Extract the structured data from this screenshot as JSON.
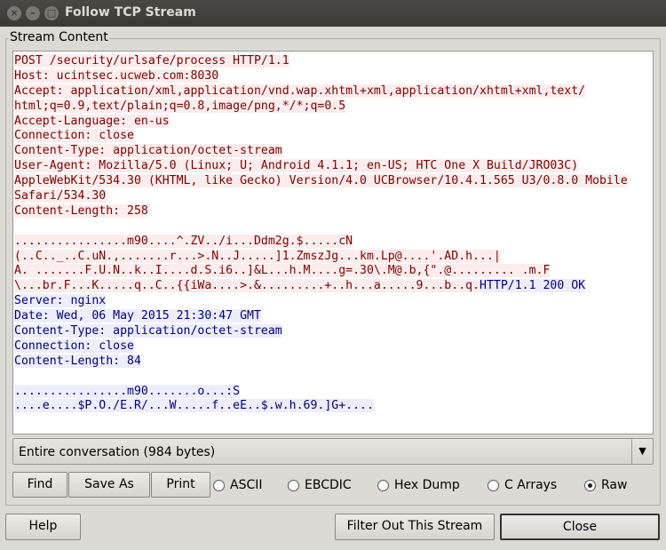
{
  "window": {
    "title": "Follow TCP Stream"
  },
  "group_label": "Stream Content",
  "stream": {
    "lines": [
      [
        {
          "t": "POST /security/urlsafe/process HTTP/1.1",
          "d": "c"
        }
      ],
      [
        {
          "t": "Host: ucintsec.ucweb.com:8030",
          "d": "c"
        }
      ],
      [
        {
          "t": "Accept: application/xml,application/vnd.wap.xhtml+xml,application/xhtml+xml,text/",
          "d": "c"
        }
      ],
      [
        {
          "t": "html;q=0.9,text/plain;q=0.8,image/png,*/*;q=0.5",
          "d": "c"
        }
      ],
      [
        {
          "t": "Accept-Language: en-us",
          "d": "c"
        }
      ],
      [
        {
          "t": "Connection: close",
          "d": "c"
        }
      ],
      [
        {
          "t": "Content-Type: application/octet-stream",
          "d": "c"
        }
      ],
      [
        {
          "t": "User-Agent: Mozilla/5.0 (Linux; U; Android 4.1.1; en-US; HTC One X Build/JRO03C)",
          "d": "c"
        }
      ],
      [
        {
          "t": "AppleWebKit/534.30 (KHTML, like Gecko) Version/4.0 UCBrowser/10.4.1.565 U3/0.8.0 Mobile",
          "d": "c"
        }
      ],
      [
        {
          "t": "Safari/534.30",
          "d": "c"
        }
      ],
      [
        {
          "t": "Content-Length: 258",
          "d": "c"
        }
      ],
      [],
      [
        {
          "t": "................m90....^.ZV../i...Ddm2g.$.....cN",
          "d": "c"
        }
      ],
      [
        {
          "t": "(..C.._..C.uN.,.......r...>.N..J.....]1.ZmszJg...km.Lp@....'.AD.h...|",
          "d": "c"
        }
      ],
      [
        {
          "t": "A. .......F.U.N..k..I....d.S.i6..]&L...h.M....g=.30\\.M@.b,{\".@......... .m.F",
          "d": "c"
        }
      ],
      [
        {
          "t": "\\...br.F...K.....q..C..{{iWa....>.&.........+..h...a.....9...b..q.",
          "d": "c"
        },
        {
          "t": "HTTP/1.1 200 OK",
          "d": "s"
        }
      ],
      [
        {
          "t": "Server: nginx",
          "d": "s"
        }
      ],
      [
        {
          "t": "Date: Wed, 06 May 2015 21:30:47 GMT",
          "d": "s"
        }
      ],
      [
        {
          "t": "Content-Type: application/octet-stream",
          "d": "s"
        }
      ],
      [
        {
          "t": "Connection: close",
          "d": "s"
        }
      ],
      [
        {
          "t": "Content-Length: 84",
          "d": "s"
        }
      ],
      [],
      [
        {
          "t": "................m90.......o...:S",
          "d": "s"
        }
      ],
      [
        {
          "t": "....e....$P.O./E.R/...W.....f..eE..$.w.h.69.]G+....",
          "d": "s"
        }
      ]
    ]
  },
  "conversation_select": "Entire conversation (984 bytes)",
  "buttons": {
    "find": "Find",
    "save_as": "Save As",
    "print": "Print",
    "help": "Help",
    "filter_out": "Filter Out This Stream",
    "close": "Close"
  },
  "formats": [
    {
      "label": "ASCII",
      "selected": false
    },
    {
      "label": "EBCDIC",
      "selected": false
    },
    {
      "label": "Hex Dump",
      "selected": false
    },
    {
      "label": "C Arrays",
      "selected": false
    },
    {
      "label": "Raw",
      "selected": true
    }
  ],
  "colors": {
    "client_fg": "#7f0000",
    "client_bg": "#fbeded",
    "server_fg": "#000080",
    "server_bg": "#ededfb"
  }
}
